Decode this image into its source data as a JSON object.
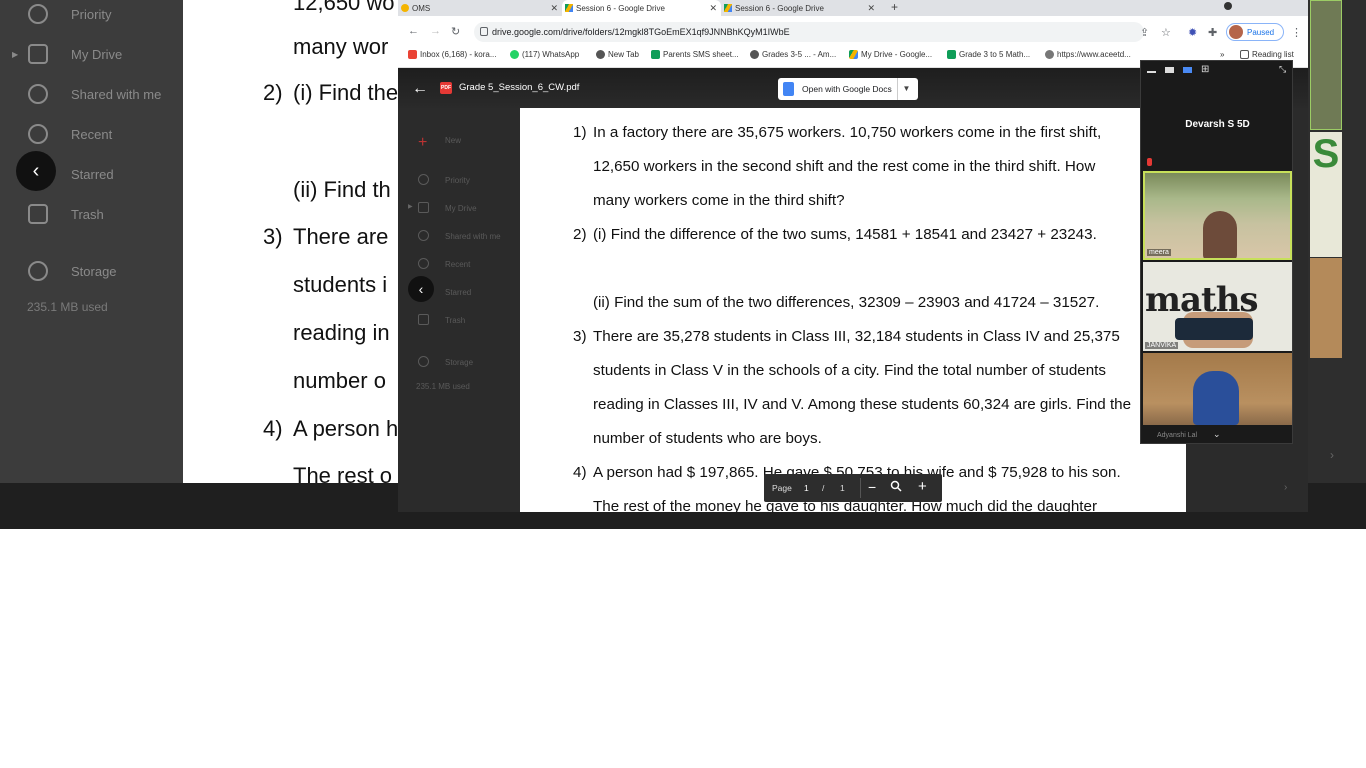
{
  "background_share": {
    "sidebar_items": [
      {
        "label": "Priority"
      },
      {
        "label": "My Drive"
      },
      {
        "label": "Shared with me"
      },
      {
        "label": "Recent"
      },
      {
        "label": "Starred"
      },
      {
        "label": "Trash"
      },
      {
        "label": "Storage"
      }
    ],
    "storage_used": "235.1 MB used",
    "doc_lines": [
      {
        "num": "",
        "text": "12,650 wo"
      },
      {
        "num": "",
        "text": "many wor"
      },
      {
        "num": "2)",
        "text": "(i) Find the"
      },
      {
        "num": "",
        "text": "(ii) Find th"
      },
      {
        "num": "3)",
        "text": "There are"
      },
      {
        "num": "",
        "text": "students i"
      },
      {
        "num": "",
        "text": "reading in"
      },
      {
        "num": "",
        "text": "number o"
      },
      {
        "num": "4)",
        "text": "A person h"
      },
      {
        "num": "",
        "text": "The rest o"
      }
    ],
    "right_tile_text": "S"
  },
  "browser": {
    "tabs": [
      {
        "label": "OMS"
      },
      {
        "label": "Session 6 - Google Drive"
      },
      {
        "label": "Session 6 - Google Drive"
      }
    ],
    "url": "drive.google.com/drive/folders/12mgkl8TGoEmEX1qf9JNNBhKQyM1IWbE",
    "profile_label": "Paused",
    "bookmarks": [
      {
        "label": "Inbox (6,168) - kora..."
      },
      {
        "label": "(117) WhatsApp"
      },
      {
        "label": "New Tab"
      },
      {
        "label": "Parents SMS sheet..."
      },
      {
        "label": "Grades 3-5 ... - Am..."
      },
      {
        "label": "My Drive - Google..."
      },
      {
        "label": "Grade 3 to 5 Math..."
      },
      {
        "label": "https://www.aceetd..."
      },
      {
        "label": "Reading list"
      }
    ]
  },
  "drive_dim": {
    "items": [
      "New",
      "Priority",
      "My Drive",
      "Shared with me",
      "Recent",
      "Starred",
      "Trash",
      "Storage"
    ],
    "storage_used": "235.1 MB used"
  },
  "viewer": {
    "file_title": "Grade 5_Session_6_CW.pdf",
    "pdf_badge": "PDF",
    "open_with_label": "Open with Google Docs",
    "page_label": "Page",
    "page_current": "1",
    "page_sep": "/",
    "page_total": "1"
  },
  "pdf_content": {
    "lines": [
      {
        "num": "1)",
        "text": "In a factory there are 35,675 workers. 10,750 workers come in the first shift,"
      },
      {
        "num": "",
        "text": "12,650 workers in the second shift and the rest come in the third shift. How"
      },
      {
        "num": "",
        "text": "many workers come in the third shift?"
      },
      {
        "num": "2)",
        "text": "(i) Find the difference of the two sums, 14581 + 18541 and 23427 + 23243."
      },
      {
        "num": "",
        "text": "(ii) Find the sum of the two differences, 32309 – 23903 and 41724 – 31527."
      },
      {
        "num": "3)",
        "text": "There are 35,278 students in Class III, 32,184 students in Class IV and 25,375"
      },
      {
        "num": "",
        "text": "students in Class V in the schools of a city. Find the total number of students"
      },
      {
        "num": "",
        "text": "reading in Classes III, IV and V. Among these students 60,324 are girls. Find the"
      },
      {
        "num": "",
        "text": "number of students who are boys."
      },
      {
        "num": "4)",
        "text": "A person had $ 197,865. He gave $ 50,753 to his wife and $ 75,928 to his son."
      },
      {
        "num": "",
        "text": "The rest of the money he gave to his daughter. How much did the daughter"
      }
    ]
  },
  "video_panel": {
    "host_name": "Devarsh S 5D",
    "tiles": [
      {
        "name": "meera"
      },
      {
        "name": "JANVIKA"
      },
      {
        "name": ""
      }
    ],
    "tile2_overlay": "maths",
    "bottom_name": "Adyanshi Lal"
  }
}
